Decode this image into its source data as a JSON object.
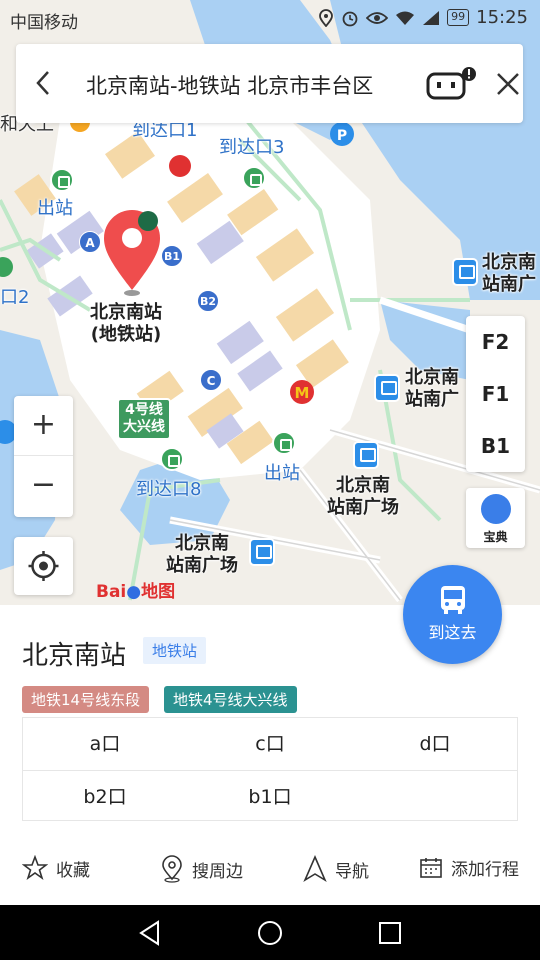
{
  "status_bar": {
    "carrier": "中国移动",
    "battery": "99",
    "time": "15:25"
  },
  "search": {
    "title": "北京南站-地铁站 北京市丰台区"
  },
  "map": {
    "labels": {
      "exit_1": "到达口1",
      "exit_3": "到达口3",
      "exit_8": "到达口8",
      "exit_2": "口2",
      "outbound_left": "出站",
      "outbound_bottom": "出站",
      "top_left_fragment": "和天上",
      "marker_name": "北京南站\n(地铁站)",
      "bus_right_top": "北京南\n站南广",
      "bus_right_mid": "北京南\n站南广",
      "bus_center": "北京南\n站南广场",
      "bus_bottom": "北京南\n站南广场",
      "line4_badge": "4号线\n大兴线"
    },
    "poi_letters": [
      "A",
      "B1",
      "B2",
      "C"
    ],
    "floors": [
      "F2",
      "F1",
      "B1"
    ],
    "baodian_label": "宝典",
    "zoom_in": "+",
    "zoom_out": "−",
    "baidu_logo_text": "Bai",
    "baidu_logo_map": "地图"
  },
  "go_button": {
    "label": "到这去"
  },
  "place": {
    "name": "北京南站",
    "type_tag": "地铁站",
    "lines": [
      {
        "label": "地铁14号线东段",
        "color": "#d48a83"
      },
      {
        "label": "地铁4号线大兴线",
        "color": "#2b9291"
      }
    ],
    "exits_row1": [
      "a口",
      "c口",
      "d口"
    ],
    "exits_row2": [
      "b2口",
      "b1口"
    ]
  },
  "actions": {
    "favorite": "收藏",
    "nearby": "搜周边",
    "navigate": "导航",
    "add_trip": "添加行程"
  },
  "colors": {
    "accent": "#3b86f0",
    "marker": "#ef4d4d"
  }
}
